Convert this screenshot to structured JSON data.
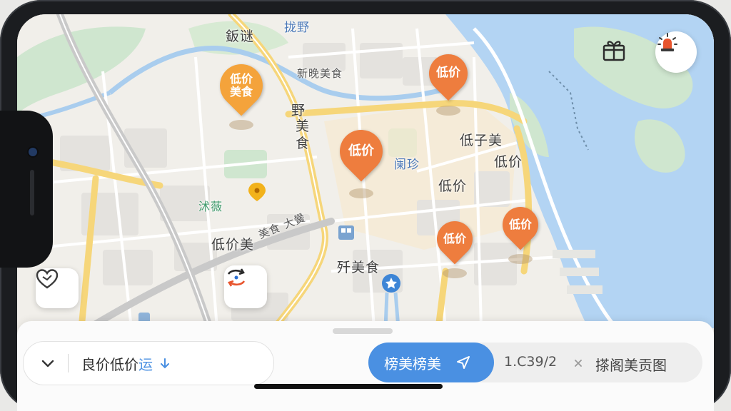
{
  "map": {
    "labels": {
      "top_a": "鈑谜",
      "top_b": "拢野",
      "xinhui": "新晚美食",
      "ye": "野",
      "meishi_v": "美食",
      "dizimei": "低子美",
      "dijia_a": "低价",
      "dijia_b": "低价",
      "lan": "阑珍",
      "bing": "沭薇",
      "mei_road": "美食 大黌",
      "dijiamei": "低价美",
      "yingmeishi": "歼美食"
    },
    "pins": [
      {
        "text": "低价\n美食",
        "color": "#f4a33b"
      },
      {
        "text": "低价",
        "color": "#ee7d3e"
      },
      {
        "text": "低价",
        "color": "#ee7d3e"
      },
      {
        "text": "低价",
        "color": "#ee7d3e"
      },
      {
        "text": "低价",
        "color": "#ee7d3e"
      }
    ]
  },
  "icons": {
    "gift": "gift-icon",
    "alert": "alert-siren-icon",
    "heart": "heart-icon",
    "route": "route-swap-icon",
    "chevron": "chevron-down-icon",
    "send": "send-arrow-icon",
    "close": "close-icon"
  },
  "bottom": {
    "selector_text": "良价低价",
    "selector_suffix": "运",
    "tab_active": "榜美榜美",
    "route_code": "1.C39/2",
    "route_name": "搽阁美贡图"
  },
  "colors": {
    "accent_blue": "#4a90e2",
    "pin_orange": "#ee7d3e",
    "pin_yellow": "#f4a33b",
    "water": "#b3d4f3"
  }
}
